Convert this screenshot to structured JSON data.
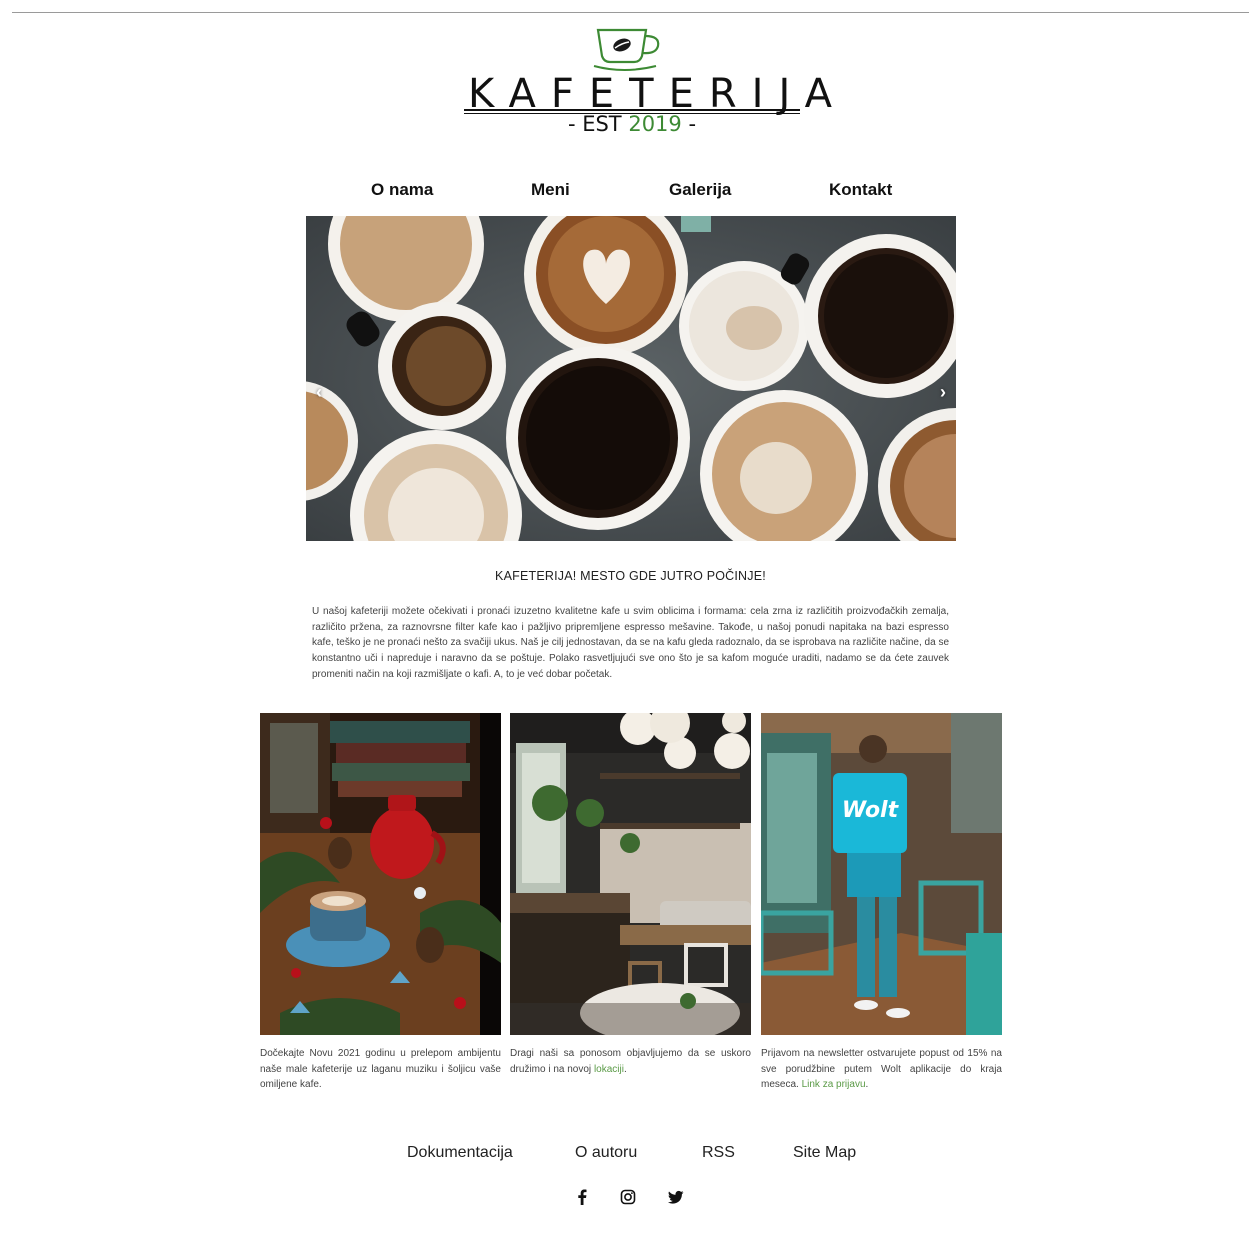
{
  "logo": {
    "wordmark": "KAFETERIJA",
    "est_prefix": "- EST",
    "est_year": "2019",
    "est_suffix": "-"
  },
  "nav": {
    "items": [
      "O nama",
      "Meni",
      "Galerija",
      "Kontakt"
    ]
  },
  "hero": {
    "prev_label": "‹",
    "next_label": "›"
  },
  "headline": "KAFETERIJA! MESTO GDE JUTRO POČINJE!",
  "intro": "U našoj kafeteriji možete očekivati i pronaći izuzetno kvalitetne kafe u svim oblicima i formama: cela zrna iz različitih proizvođačkih zemalja, različito pržena, za raznovrsne filter kafe kao i pažljivo pripremljene espresso mešavine. Takođe, u našoj ponudi napitaka na bazi espresso kafe, teško je ne pronaći nešto za svačiji ukus. Naš je cilj jednostavan, da se na kafu gleda radoznalo, da se isprobava na različite načine, da se konstantno uči i napreduje i naravno da se poštuje. Polako rasvetljujući sve ono što je sa kafom moguće uraditi, nadamo se da ćete zauvek promeniti način na koji razmišljate o kafi. A, to je već dobar početak.",
  "cards": [
    {
      "text": "Dočekajte Novu 2021 godinu u prelepom ambijentu naše male kafeterije uz laganu muziku i šoljicu vaše omiljene kafe.",
      "link": "",
      "tail": ""
    },
    {
      "text": "Dragi naši sa ponosom objavljujemo da se uskoro družimo i na novoj ",
      "link": "lokaciji",
      "tail": "."
    },
    {
      "text": "Prijavom na newsletter ostvarujete popust od 15% na sve porudžbine putem Wolt aplikacije do kraja meseca. ",
      "link": "Link za prijavu",
      "tail": "."
    }
  ],
  "card_badge": "Wolt",
  "footer": {
    "links": [
      "Dokumentacija",
      "O autoru",
      "RSS",
      "Site Map"
    ],
    "social": [
      "facebook-icon",
      "instagram-icon",
      "twitter-icon"
    ]
  },
  "colors": {
    "accent_green": "#3d8a34",
    "link_green": "#5a9a46"
  }
}
